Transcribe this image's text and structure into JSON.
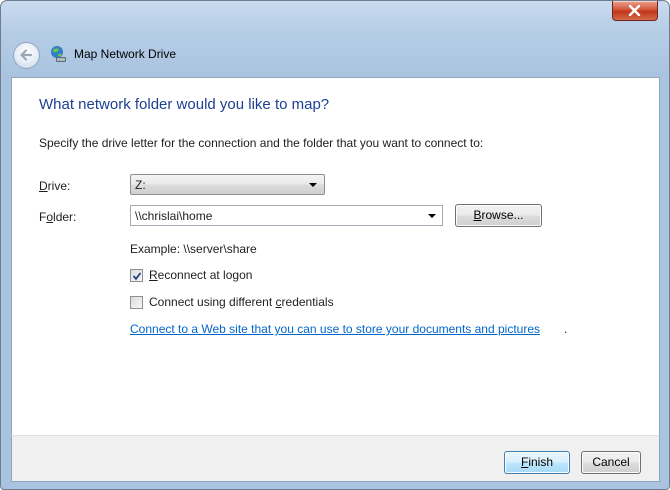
{
  "window": {
    "title": "Map Network Drive"
  },
  "page": {
    "heading": "What network folder would you like to map?",
    "instructions": "Specify the drive letter for the connection and the folder that you want to connect to:"
  },
  "drive": {
    "label_mnemonic": "D",
    "label_rest": "rive:",
    "value": "Z:"
  },
  "folder": {
    "label_pre": "F",
    "label_mnemonic": "o",
    "label_rest": "lder:",
    "value": "\\\\chrislai\\home"
  },
  "browse": {
    "mnemonic": "B",
    "rest": "rowse..."
  },
  "example": "Example: \\\\server\\share",
  "reconnect": {
    "checked": true,
    "mnemonic": "R",
    "rest": "econnect at logon"
  },
  "credentials": {
    "checked": false,
    "pre": "Connect using different ",
    "mnemonic": "c",
    "rest": "redentials"
  },
  "web_link": {
    "text": "Connect to a Web site that you can use to store your documents and pictures",
    "suffix": "."
  },
  "buttons": {
    "finish": {
      "mnemonic": "F",
      "rest": "inish"
    },
    "cancel": "Cancel"
  },
  "colors": {
    "heading": "#1d3f94",
    "link": "#0066cc",
    "close": "#c2361a"
  }
}
